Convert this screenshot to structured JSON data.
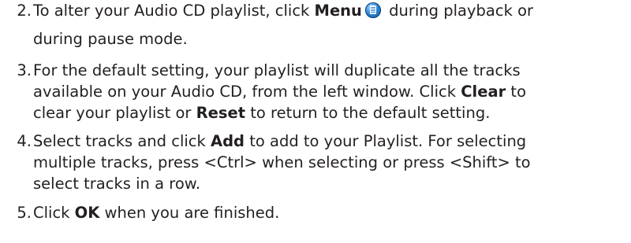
{
  "steps": [
    {
      "number": "2.",
      "lines": [
        {
          "t1": "To alter your Audio CD playlist, click ",
          "b1": "Menu",
          "t2": " during playback or"
        },
        {
          "t1": "during pause mode."
        }
      ],
      "icon": "menu-icon"
    },
    {
      "number": "3.",
      "lines": [
        {
          "t1": "For the default setting, your playlist will duplicate all the tracks"
        },
        {
          "t1": "available on your Audio CD, from the left window. Click ",
          "b1": "Clear",
          "t2": " to"
        },
        {
          "t1": "clear your playlist or ",
          "b1": "Reset",
          "t2": " to return to the default setting."
        }
      ]
    },
    {
      "number": "4.",
      "lines": [
        {
          "t1": "Select tracks and click ",
          "b1": "Add",
          "t2": " to add to your Playlist. For selecting"
        },
        {
          "t1": "multiple tracks, press <Ctrl> when selecting or press <Shift> to"
        },
        {
          "t1": "select tracks in a row."
        }
      ]
    },
    {
      "number": "5.",
      "lines": [
        {
          "t1": "Click ",
          "b1": "OK",
          "t2": " when you are finished."
        }
      ]
    }
  ]
}
